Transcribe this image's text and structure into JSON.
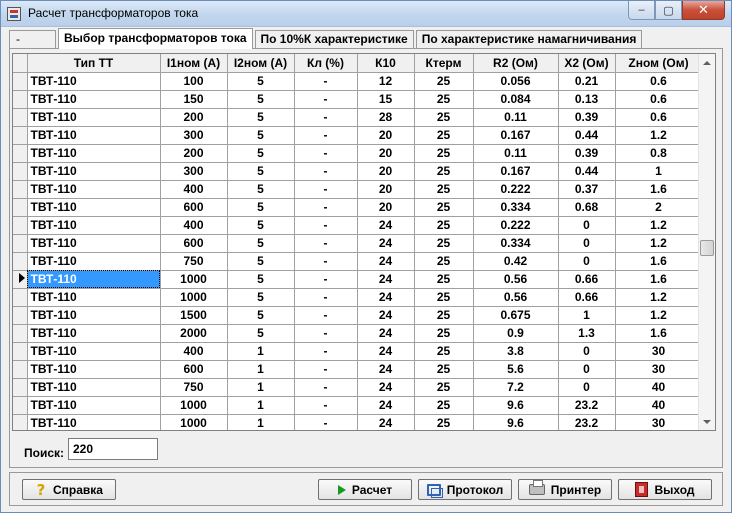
{
  "window": {
    "title": "Расчет трансформаторов тока",
    "min": "‒",
    "max": "▢",
    "close": "✕"
  },
  "tabs": [
    {
      "label": "-"
    },
    {
      "label": "Выбор трансформаторов тока"
    },
    {
      "label": "По 10%К характеристике"
    },
    {
      "label": "По характеристике намагничивания"
    }
  ],
  "grid": {
    "columns": [
      "Тип ТТ",
      "I1ном (А)",
      "I2ном (А)",
      "Кл (%)",
      "К10",
      "Ктерм",
      "R2 (Ом)",
      "X2 (Ом)",
      "Zном (Ом)"
    ],
    "rows": [
      [
        "ТВТ-110",
        "100",
        "5",
        "-",
        "12",
        "25",
        "0.056",
        "0.21",
        "0.6"
      ],
      [
        "ТВТ-110",
        "150",
        "5",
        "-",
        "15",
        "25",
        "0.084",
        "0.13",
        "0.6"
      ],
      [
        "ТВТ-110",
        "200",
        "5",
        "-",
        "28",
        "25",
        "0.11",
        "0.39",
        "0.6"
      ],
      [
        "ТВТ-110",
        "300",
        "5",
        "-",
        "20",
        "25",
        "0.167",
        "0.44",
        "1.2"
      ],
      [
        "ТВТ-110",
        "200",
        "5",
        "-",
        "20",
        "25",
        "0.11",
        "0.39",
        "0.8"
      ],
      [
        "ТВТ-110",
        "300",
        "5",
        "-",
        "20",
        "25",
        "0.167",
        "0.44",
        "1"
      ],
      [
        "ТВТ-110",
        "400",
        "5",
        "-",
        "20",
        "25",
        "0.222",
        "0.37",
        "1.6"
      ],
      [
        "ТВТ-110",
        "600",
        "5",
        "-",
        "20",
        "25",
        "0.334",
        "0.68",
        "2"
      ],
      [
        "ТВТ-110",
        "400",
        "5",
        "-",
        "24",
        "25",
        "0.222",
        "0",
        "1.2"
      ],
      [
        "ТВТ-110",
        "600",
        "5",
        "-",
        "24",
        "25",
        "0.334",
        "0",
        "1.2"
      ],
      [
        "ТВТ-110",
        "750",
        "5",
        "-",
        "24",
        "25",
        "0.42",
        "0",
        "1.6"
      ],
      [
        "ТВТ-110",
        "1000",
        "5",
        "-",
        "24",
        "25",
        "0.56",
        "0.66",
        "1.6"
      ],
      [
        "ТВТ-110",
        "1000",
        "5",
        "-",
        "24",
        "25",
        "0.56",
        "0.66",
        "1.2"
      ],
      [
        "ТВТ-110",
        "1500",
        "5",
        "-",
        "24",
        "25",
        "0.675",
        "1",
        "1.2"
      ],
      [
        "ТВТ-110",
        "2000",
        "5",
        "-",
        "24",
        "25",
        "0.9",
        "1.3",
        "1.6"
      ],
      [
        "ТВТ-110",
        "400",
        "1",
        "-",
        "24",
        "25",
        "3.8",
        "0",
        "30"
      ],
      [
        "ТВТ-110",
        "600",
        "1",
        "-",
        "24",
        "25",
        "5.6",
        "0",
        "30"
      ],
      [
        "ТВТ-110",
        "750",
        "1",
        "-",
        "24",
        "25",
        "7.2",
        "0",
        "40"
      ],
      [
        "ТВТ-110",
        "1000",
        "1",
        "-",
        "24",
        "25",
        "9.6",
        "23.2",
        "40"
      ],
      [
        "ТВТ-110",
        "1000",
        "1",
        "-",
        "24",
        "25",
        "9.6",
        "23.2",
        "30"
      ]
    ],
    "selected_row": 11
  },
  "search": {
    "label": "Поиск:",
    "value": "220"
  },
  "buttons": {
    "help": "Справка",
    "calc": "Расчет",
    "protocol": "Протокол",
    "printer": "Принтер",
    "exit": "Выход"
  },
  "colors": {
    "selection": "#3399ff",
    "title_gradient": "#c3d7ee",
    "close_button": "#c9503b"
  }
}
